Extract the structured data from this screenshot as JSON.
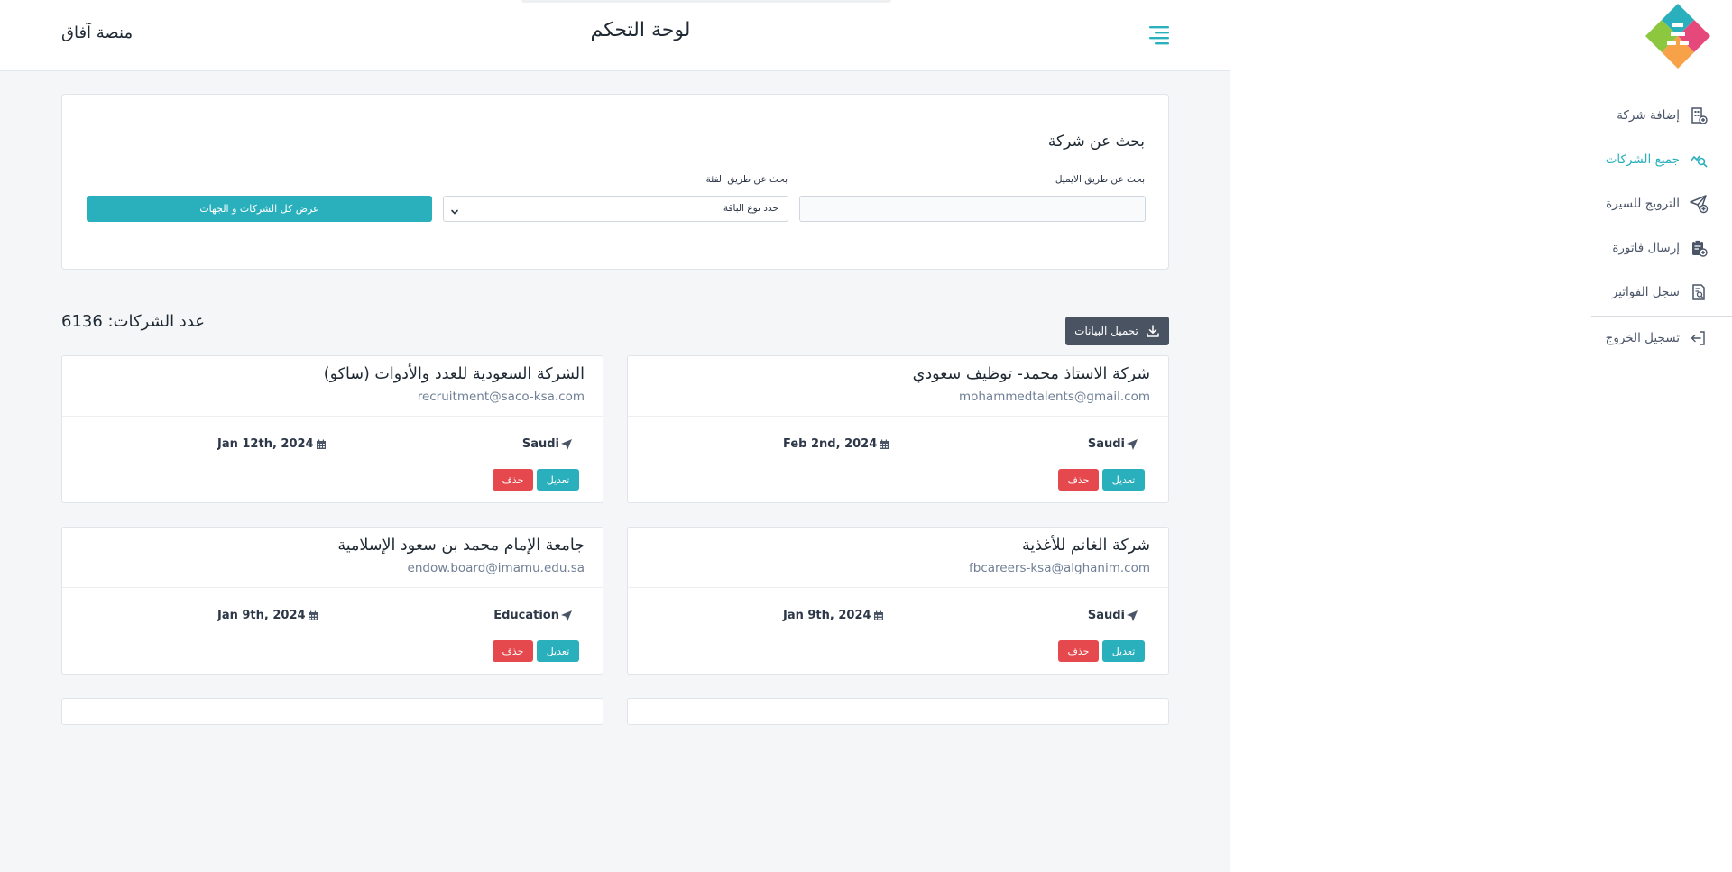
{
  "header": {
    "brand": "منصة آفاق",
    "page_title": "لوحة التحكم"
  },
  "sidebar": {
    "items": [
      {
        "label": "إضافة شركة",
        "icon": "building-add-icon"
      },
      {
        "label": "جميع الشركات",
        "icon": "search-chart-icon",
        "active": true
      },
      {
        "label": "الترويج للسيرة",
        "icon": "send-add-icon"
      },
      {
        "label": "إرسال فاتورة",
        "icon": "clipboard-add-icon"
      },
      {
        "label": "سجل الفواتير",
        "icon": "document-search-icon"
      }
    ],
    "logout": {
      "label": "تسجيل الخروج",
      "icon": "logout-icon"
    }
  },
  "search": {
    "title": "بحث عن شركة",
    "email_label": "بحث عن طريق الايميل",
    "email_value": "",
    "category_label": "بحث عن طريق الفئة",
    "category_selected": "حدد نوع الباقة",
    "show_all_label": "عرض كل الشركات و الجهات"
  },
  "summary": {
    "count_label": "عدد الشركات:",
    "count_value": "6136",
    "download_label": "تحميل البيانات"
  },
  "companies": [
    {
      "name": "شركة الاستاذ محمد- توظيف سعودي",
      "email": "mohammedtalents@gmail.com",
      "location": "Saudi",
      "date": "Feb 2nd, 2024",
      "edit_label": "تعديل",
      "delete_label": "حذف"
    },
    {
      "name": "الشركة السعودية للعدد والأدوات (ساكو)",
      "email": "recruitment@saco-ksa.com",
      "location": "Saudi",
      "date": "Jan 12th, 2024",
      "edit_label": "تعديل",
      "delete_label": "حذف"
    },
    {
      "name": "شركة الغانم للأغذية",
      "email": "fbcareers-ksa@alghanim.com",
      "location": "Saudi",
      "date": "Jan 9th, 2024",
      "edit_label": "تعديل",
      "delete_label": "حذف"
    },
    {
      "name": "جامعة الإمام محمد بن سعود الإسلامية",
      "email": "endow.board@imamu.edu.sa",
      "location": "Education",
      "date": "Jan 9th, 2024",
      "edit_label": "تعديل",
      "delete_label": "حذف"
    }
  ],
  "colors": {
    "accent": "#2ab0bd",
    "danger": "#e5484d",
    "dark_button": "#4a5361",
    "background": "#f4f6f8"
  }
}
